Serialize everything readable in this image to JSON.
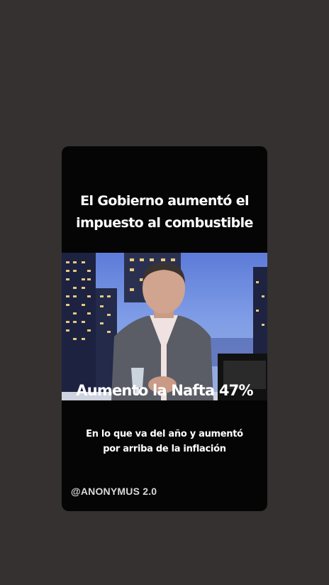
{
  "headline": {
    "line1": "El Gobierno aumentó el",
    "line2": "impuesto al combustible"
  },
  "caption": {
    "main": "Aumento la Nafta 47%",
    "sub_line1": "En lo que va del año y aumentó",
    "sub_line2": "por arriba de la inflación"
  },
  "watermark": "@ANONYMUS 2.0",
  "colors": {
    "page_background": "#353131",
    "card_background": "#050505",
    "text": "#ffffff",
    "watermark": "#d9d9d9"
  }
}
